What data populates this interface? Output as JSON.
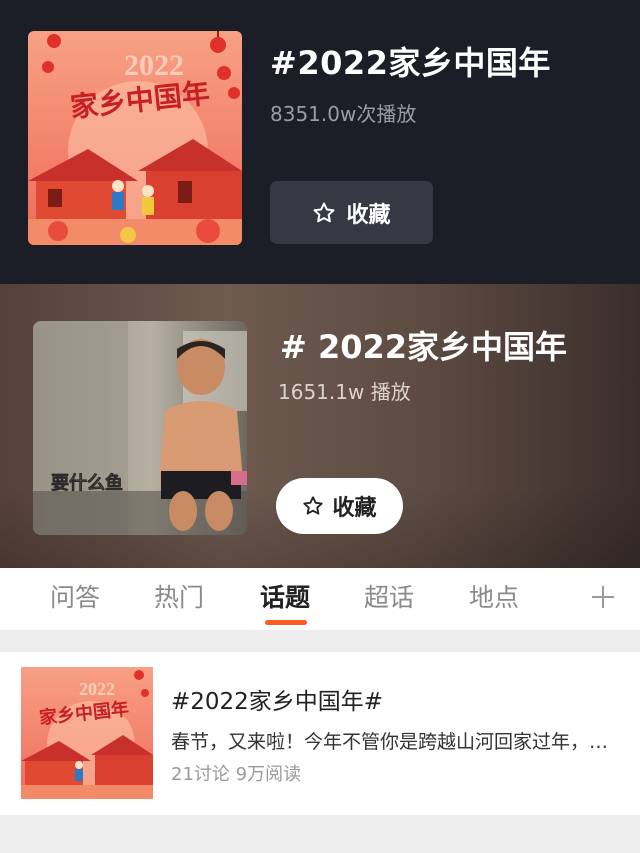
{
  "topic_card_1": {
    "title": "#2022家乡中国年",
    "plays": "8351.0w次播放",
    "favorite_label": "收藏",
    "cover_year": "2022",
    "cover_text": "家乡中国年"
  },
  "topic_card_2": {
    "title": "# 2022家乡中国年",
    "plays": "1651.1w 播放",
    "favorite_label": "收藏",
    "cover_caption": "要什么鱼"
  },
  "tabs": [
    {
      "label": "问答",
      "active": false
    },
    {
      "label": "热门",
      "active": false
    },
    {
      "label": "话题",
      "active": true
    },
    {
      "label": "超话",
      "active": false
    },
    {
      "label": "地点",
      "active": false
    }
  ],
  "tabs_more_icon": "plus-icon",
  "results": [
    {
      "title": "#2022家乡中国年#",
      "description": "春节，又来啦！今年不管你是跨越山河回家过年，还是",
      "meta": "21讨论 9万阅读",
      "cover_year": "2022",
      "cover_text": "家乡中国年"
    }
  ],
  "colors": {
    "dark_bg": "#1b1e27",
    "accent_orange": "#ff5a1f",
    "cover_pink": "#f47a64"
  }
}
